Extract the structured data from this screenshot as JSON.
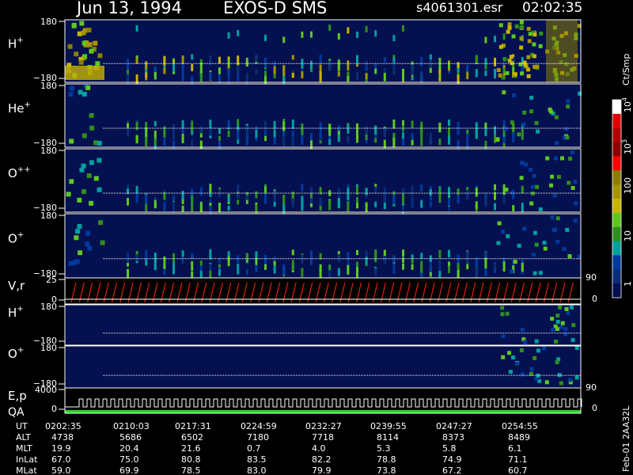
{
  "header": {
    "date": "Jun 13, 1994",
    "instrument": "EXOS-D SMS",
    "file": "s4061301.esr",
    "time": "02:02:35"
  },
  "panels": [
    {
      "label": "H",
      "sup": "+",
      "tick_top": "180",
      "tick_bottom": "−180"
    },
    {
      "label": "He",
      "sup": "+",
      "tick_top": "180",
      "tick_bottom": "−180"
    },
    {
      "label": "O",
      "sup": "++",
      "tick_top": "180",
      "tick_bottom": "−180"
    },
    {
      "label": "O",
      "sup": "+",
      "tick_top": "180",
      "tick_bottom": "−180"
    },
    {
      "label": "V,r",
      "sup": "",
      "tick_top": "25",
      "tick_bottom": "0",
      "right_top": "90",
      "right_bottom": "0"
    },
    {
      "label": "H",
      "sup": "+",
      "tick_top": "180",
      "tick_bottom": "−180"
    },
    {
      "label": "O",
      "sup": "+",
      "tick_top": "180",
      "tick_bottom": "−180"
    },
    {
      "label": "E,p",
      "sup": "",
      "label2": "QA",
      "tick_top": "4000",
      "tick_bottom": "0",
      "right_top": "90",
      "right_bottom": "0"
    }
  ],
  "colorbar": {
    "unit": "Ct/Smp",
    "labels": [
      "10",
      "10",
      "100",
      "10",
      "1"
    ],
    "exponents": [
      "4",
      "3",
      "",
      "",
      ""
    ],
    "colors": [
      "#ffffff",
      "#e00000",
      "#b00000",
      "#8b0000",
      "#ff0000",
      "#8c7d00",
      "#a89400",
      "#c8b400",
      "#5ec81e",
      "#2f8f1e",
      "#00a0a0",
      "#003aa0",
      "#0a2d7a",
      "#04104f"
    ]
  },
  "side_label": "Feb-01 2AA32L",
  "ephemeris": {
    "rows": [
      {
        "name": "UT",
        "values": [
          "0202:35",
          "0210:03",
          "0217:31",
          "0224:59",
          "0232:27",
          "0239:55",
          "0247:27",
          "0254:55"
        ]
      },
      {
        "name": "ALT",
        "values": [
          "4738",
          "5686",
          "6502",
          "7180",
          "7718",
          "8114",
          "8373",
          "8489"
        ]
      },
      {
        "name": "MLT",
        "values": [
          "19.9",
          "20.4",
          "21.6",
          "0.7",
          "4.0",
          "5.3",
          "5.8",
          "6.1"
        ]
      },
      {
        "name": "InLat",
        "values": [
          "67.0",
          "75.0",
          "80.8",
          "83.5",
          "82.2",
          "78.8",
          "74.9",
          "71.1"
        ]
      },
      {
        "name": "MLat",
        "values": [
          "59.0",
          "69.9",
          "78.5",
          "83.0",
          "79.9",
          "73.8",
          "67.2",
          "60.7"
        ]
      }
    ]
  },
  "chart_data": {
    "type": "heatmap",
    "title": "Jun 13, 1994   EXOS-D SMS",
    "x_ticks": [
      "0202:35",
      "0210:03",
      "0217:31",
      "0224:59",
      "0232:27",
      "0239:55",
      "0247:27",
      "0254:55"
    ],
    "colorbar_unit": "Ct/Smp",
    "colorbar_scale": "log",
    "colorbar_range": [
      1,
      10000
    ],
    "panels": [
      {
        "label": "H+",
        "ylim": [
          -180,
          180
        ],
        "spin_count": 44,
        "intensity": "high"
      },
      {
        "label": "He+",
        "ylim": [
          -180,
          180
        ],
        "spin_count": 44,
        "intensity": "medium"
      },
      {
        "label": "O++",
        "ylim": [
          -180,
          180
        ],
        "spin_count": 44,
        "intensity": "medium"
      },
      {
        "label": "O+",
        "ylim": [
          -180,
          180
        ],
        "spin_count": 44,
        "intensity": "medium"
      },
      {
        "label": "V,r",
        "ylim": [
          0,
          25
        ],
        "right_ylim": [
          0,
          90
        ],
        "type": "line"
      },
      {
        "label": "H+",
        "ylim": [
          -180,
          180
        ],
        "intensity": "low"
      },
      {
        "label": "O+",
        "ylim": [
          -180,
          180
        ],
        "intensity": "low"
      },
      {
        "label": "E,p QA",
        "ylim": [
          0,
          4000
        ],
        "right_ylim": [
          0,
          90
        ],
        "type": "step"
      }
    ]
  }
}
